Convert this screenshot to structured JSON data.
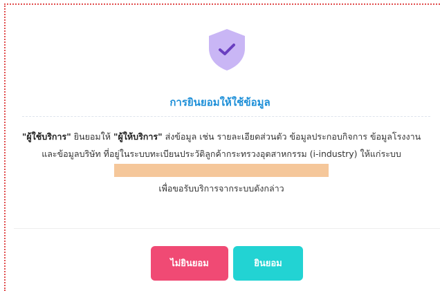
{
  "dialog": {
    "title": "การยินยอมให้ใช้ข้อมูล",
    "shield_icon": "shield-check-icon",
    "body": {
      "user_term": "\"ผู้ใช้บริการ\"",
      "text_1": " ยินยอมให้ ",
      "provider_term": "\"ผู้ให้บริการ\"",
      "text_2": " ส่งข้อมูล เช่น รายละเอียดส่วนตัว ข้อมูลประกอบกิจการ ข้อมูลโรงงาน และข้อมูลบริษัท ที่อยู่ในระบบทะเบียนประวัติลูกค้ากระทรวงอุตสาหกรรม (i-industry) ให้แก่ระบบ",
      "text_3": "เพื่อขอรับบริการจากระบบดังกล่าว"
    },
    "buttons": {
      "decline_label": "ไม่ยินยอม",
      "accept_label": "ยินยอม"
    }
  },
  "colors": {
    "title": "#1d8fd8",
    "shield": "#c9b6f5",
    "check": "#6a3fc0",
    "decline": "#f04a74",
    "accept": "#22d3d3",
    "redaction": "#f5c79a",
    "border_dots": "#e04a4a"
  }
}
